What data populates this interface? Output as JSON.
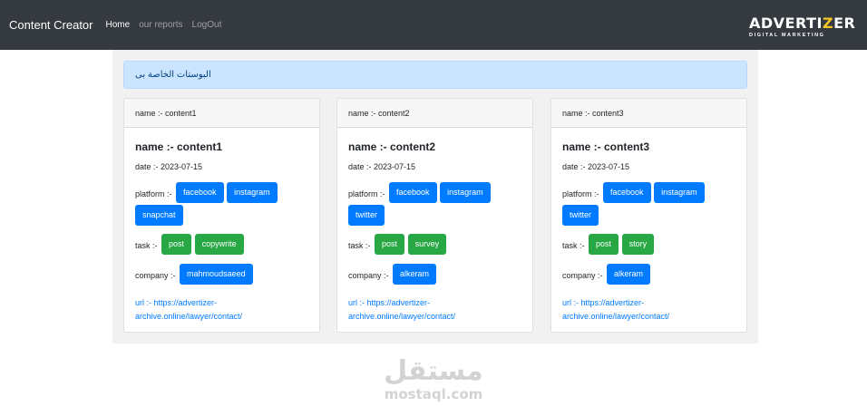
{
  "navbar": {
    "brand": "Content Creator",
    "links": [
      {
        "label": "Home",
        "active": true
      },
      {
        "label": "our reports",
        "active": false
      },
      {
        "label": "LogOut",
        "active": false
      }
    ],
    "logo": {
      "part1": "ADVERTI",
      "part2": "Z",
      "part3": "ER",
      "subtitle": "DIGITAL MARKETING"
    }
  },
  "alert": {
    "text": "البوستات الخاصة بى"
  },
  "cards": [
    {
      "header": "name :- content1",
      "title": "name :- content1",
      "date": "date :- 2023-07-15",
      "platform_label": "platform :-",
      "platforms": [
        "facebook",
        "instagram",
        "snapchat"
      ],
      "task_label": "task :-",
      "tasks": [
        "post",
        "copywrite"
      ],
      "company_label": "company :-",
      "company": "mahmoudsaeed",
      "url": "url :- https://advertizer-archive.online/lawyer/contact/"
    },
    {
      "header": "name :- content2",
      "title": "name :- content2",
      "date": "date :- 2023-07-15",
      "platform_label": "platform :-",
      "platforms": [
        "facebook",
        "instagram",
        "twitter"
      ],
      "task_label": "task :-",
      "tasks": [
        "post",
        "survey"
      ],
      "company_label": "company :-",
      "company": "alkeram",
      "url": "url :- https://advertizer-archive.online/lawyer/contact/"
    },
    {
      "header": "name :- content3",
      "title": "name :- content3",
      "date": "date :- 2023-07-15",
      "platform_label": "platform :-",
      "platforms": [
        "facebook",
        "instagram",
        "twitter"
      ],
      "task_label": "task :-",
      "tasks": [
        "post",
        "story"
      ],
      "company_label": "company :-",
      "company": "alkeram",
      "url": "url :- https://advertizer-archive.online/lawyer/contact/"
    }
  ],
  "watermark": {
    "arabic": "مستقل",
    "latin": "mostaql.com"
  },
  "colors": {
    "navbar": "#343a40",
    "primary": "#007bff",
    "success": "#28a745",
    "alert_bg": "#cce5ff",
    "logo_accent": "#f3c623"
  }
}
